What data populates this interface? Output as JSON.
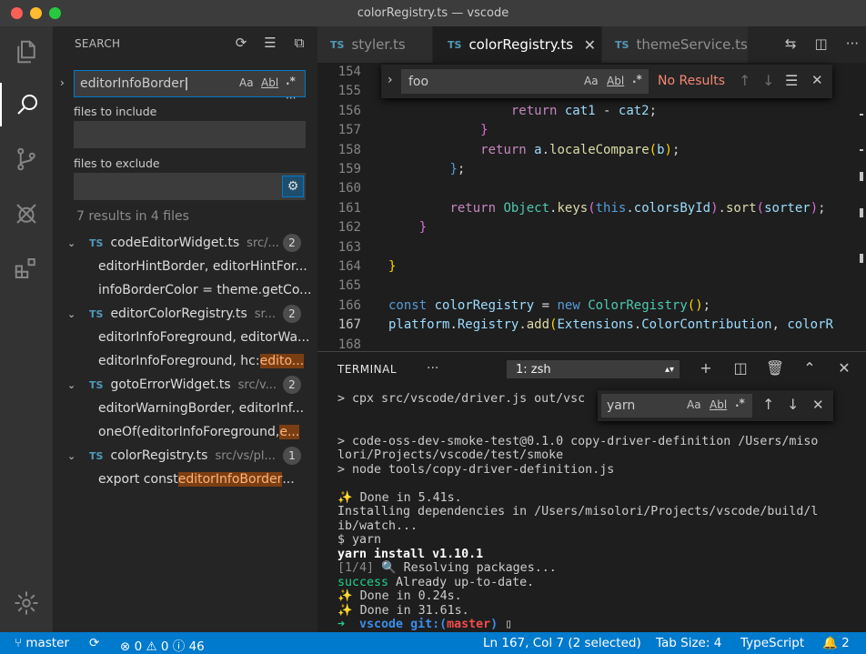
{
  "window": {
    "title": "colorRegistry.ts — vscode"
  },
  "colors": {
    "accent": "#007acc",
    "statusbar": "#007acc",
    "match_highlight": "#7b3e13",
    "no_results": "#f48771"
  },
  "sidebar": {
    "title": "SEARCH",
    "search_value": "editorInfoBorder",
    "include_label": "files to include",
    "include_value": "",
    "exclude_label": "files to exclude",
    "exclude_value": "",
    "more": "···",
    "summary": "7 results in 4 files",
    "options": {
      "case": "Aa",
      "word": "Abl",
      "regex": ".*"
    },
    "files": [
      {
        "name": "codeEditorWidget.ts",
        "path": "src/...",
        "count": "2",
        "matches": [
          {
            "pre": "editorHintBorder, editorHintFor...",
            "hl": "",
            "post": ""
          },
          {
            "pre": "infoBorderColor = theme.getCo...",
            "hl": "",
            "post": ""
          }
        ]
      },
      {
        "name": "editorColorRegistry.ts",
        "path": "sr...",
        "count": "2",
        "matches": [
          {
            "pre": "editorInfoForeground, editorWa...",
            "hl": "",
            "post": ""
          },
          {
            "pre": "editorInfoForeground, hc: ",
            "hl": "edito...",
            "post": ""
          }
        ]
      },
      {
        "name": "gotoErrorWidget.ts",
        "path": "src/v...",
        "count": "2",
        "matches": [
          {
            "pre": "editorWarningBorder, editorInf...",
            "hl": "",
            "post": ""
          },
          {
            "pre": "oneOf(editorInfoForeground, ",
            "hl": "e...",
            "post": ""
          }
        ]
      },
      {
        "name": "colorRegistry.ts",
        "path": "src/vs/pl...",
        "count": "1",
        "matches": [
          {
            "pre": "export const ",
            "hl": "editorInfoBorder",
            "post": " ..."
          }
        ]
      }
    ]
  },
  "tabs": [
    {
      "label": "styler.ts",
      "lang": "TS",
      "active": false
    },
    {
      "label": "colorRegistry.ts",
      "lang": "TS",
      "active": true
    },
    {
      "label": "themeService.ts",
      "lang": "TS",
      "active": false
    }
  ],
  "editor_find": {
    "value": "foo",
    "status": "No Results",
    "case": "Aa",
    "word": "Abl",
    "regex": ".*"
  },
  "editor": {
    "current_line": "167",
    "lines": [
      {
        "n": "154",
        "html": ""
      },
      {
        "n": "155",
        "html": ""
      },
      {
        "n": "156",
        "html": "                <span class='kw'>return</span> <span class='var'>cat1</span> - <span class='var'>cat2</span>;"
      },
      {
        "n": "157",
        "html": "            <span class='br2'>}</span>"
      },
      {
        "n": "158",
        "html": "            <span class='kw'>return</span> <span class='var'>a</span>.<span class='fn'>localeCompare</span><span class='br'>(</span><span class='var'>b</span><span class='br'>)</span>;"
      },
      {
        "n": "159",
        "html": "        <span class='kw2'>}</span>;"
      },
      {
        "n": "160",
        "html": ""
      },
      {
        "n": "161",
        "html": "        <span class='kw'>return</span> <span class='cls'>Object</span>.<span class='fn'>keys</span><span class='br2'>(</span><span class='kw2'>this</span>.<span class='var'>colorsById</span><span class='br2'>)</span>.<span class='fn'>sort</span><span class='br2'>(</span><span class='var'>sorter</span><span class='br2'>)</span>;"
      },
      {
        "n": "162",
        "html": "    <span class='br2'>}</span>"
      },
      {
        "n": "163",
        "html": ""
      },
      {
        "n": "164",
        "html": "<span class='br'>}</span>"
      },
      {
        "n": "165",
        "html": ""
      },
      {
        "n": "166",
        "html": "<span class='kw2'>const</span> <span class='var'>colorRegistry</span> = <span class='kw2'>new</span> <span class='cls'>ColorRegistry</span><span class='br'>()</span>;"
      },
      {
        "n": "167",
        "html": "<span class='var'>platform</span>.<span class='var'>Registry</span>.<span class='fn'>add</span><span class='br'>(</span><span class='var'>Extensions</span>.<span class='var'>ColorContribution</span>, <span class='var'>colorR</span>"
      },
      {
        "n": "168",
        "html": ""
      }
    ]
  },
  "terminal": {
    "title": "TERMINAL",
    "more": "···",
    "shell": "1: zsh",
    "find_value": "yarn",
    "find_case": "Aa",
    "find_word": "Abl",
    "find_regex": ".*",
    "lines": [
      "> cpx src/vscode/driver.js out/vsc",
      "",
      "",
      "> code-oss-dev-smoke-test@0.1.0 copy-driver-definition /Users/miso",
      "lori/Projects/vscode/test/smoke",
      "> node tools/copy-driver-definition.js",
      "",
      "✨ Done in 5.41s.",
      "Installing dependencies in /Users/misolori/Projects/vscode/build/l",
      "ib/watch...",
      "$ yarn",
      "yarn install v1.10.1",
      "[1/4] 🔍 Resolving packages...",
      "success Already up-to-date.",
      "✨ Done in 0.24s.",
      "✨ Done in 31.61s.",
      "➜  vscode git:(master) ▯"
    ]
  },
  "status": {
    "branch": "master",
    "errors": "0",
    "warnings": "0",
    "infos": "46",
    "position": "Ln 167, Col 7 (2 selected)",
    "tab_size": "Tab Size: 4",
    "language": "TypeScript",
    "notifications": "2"
  }
}
